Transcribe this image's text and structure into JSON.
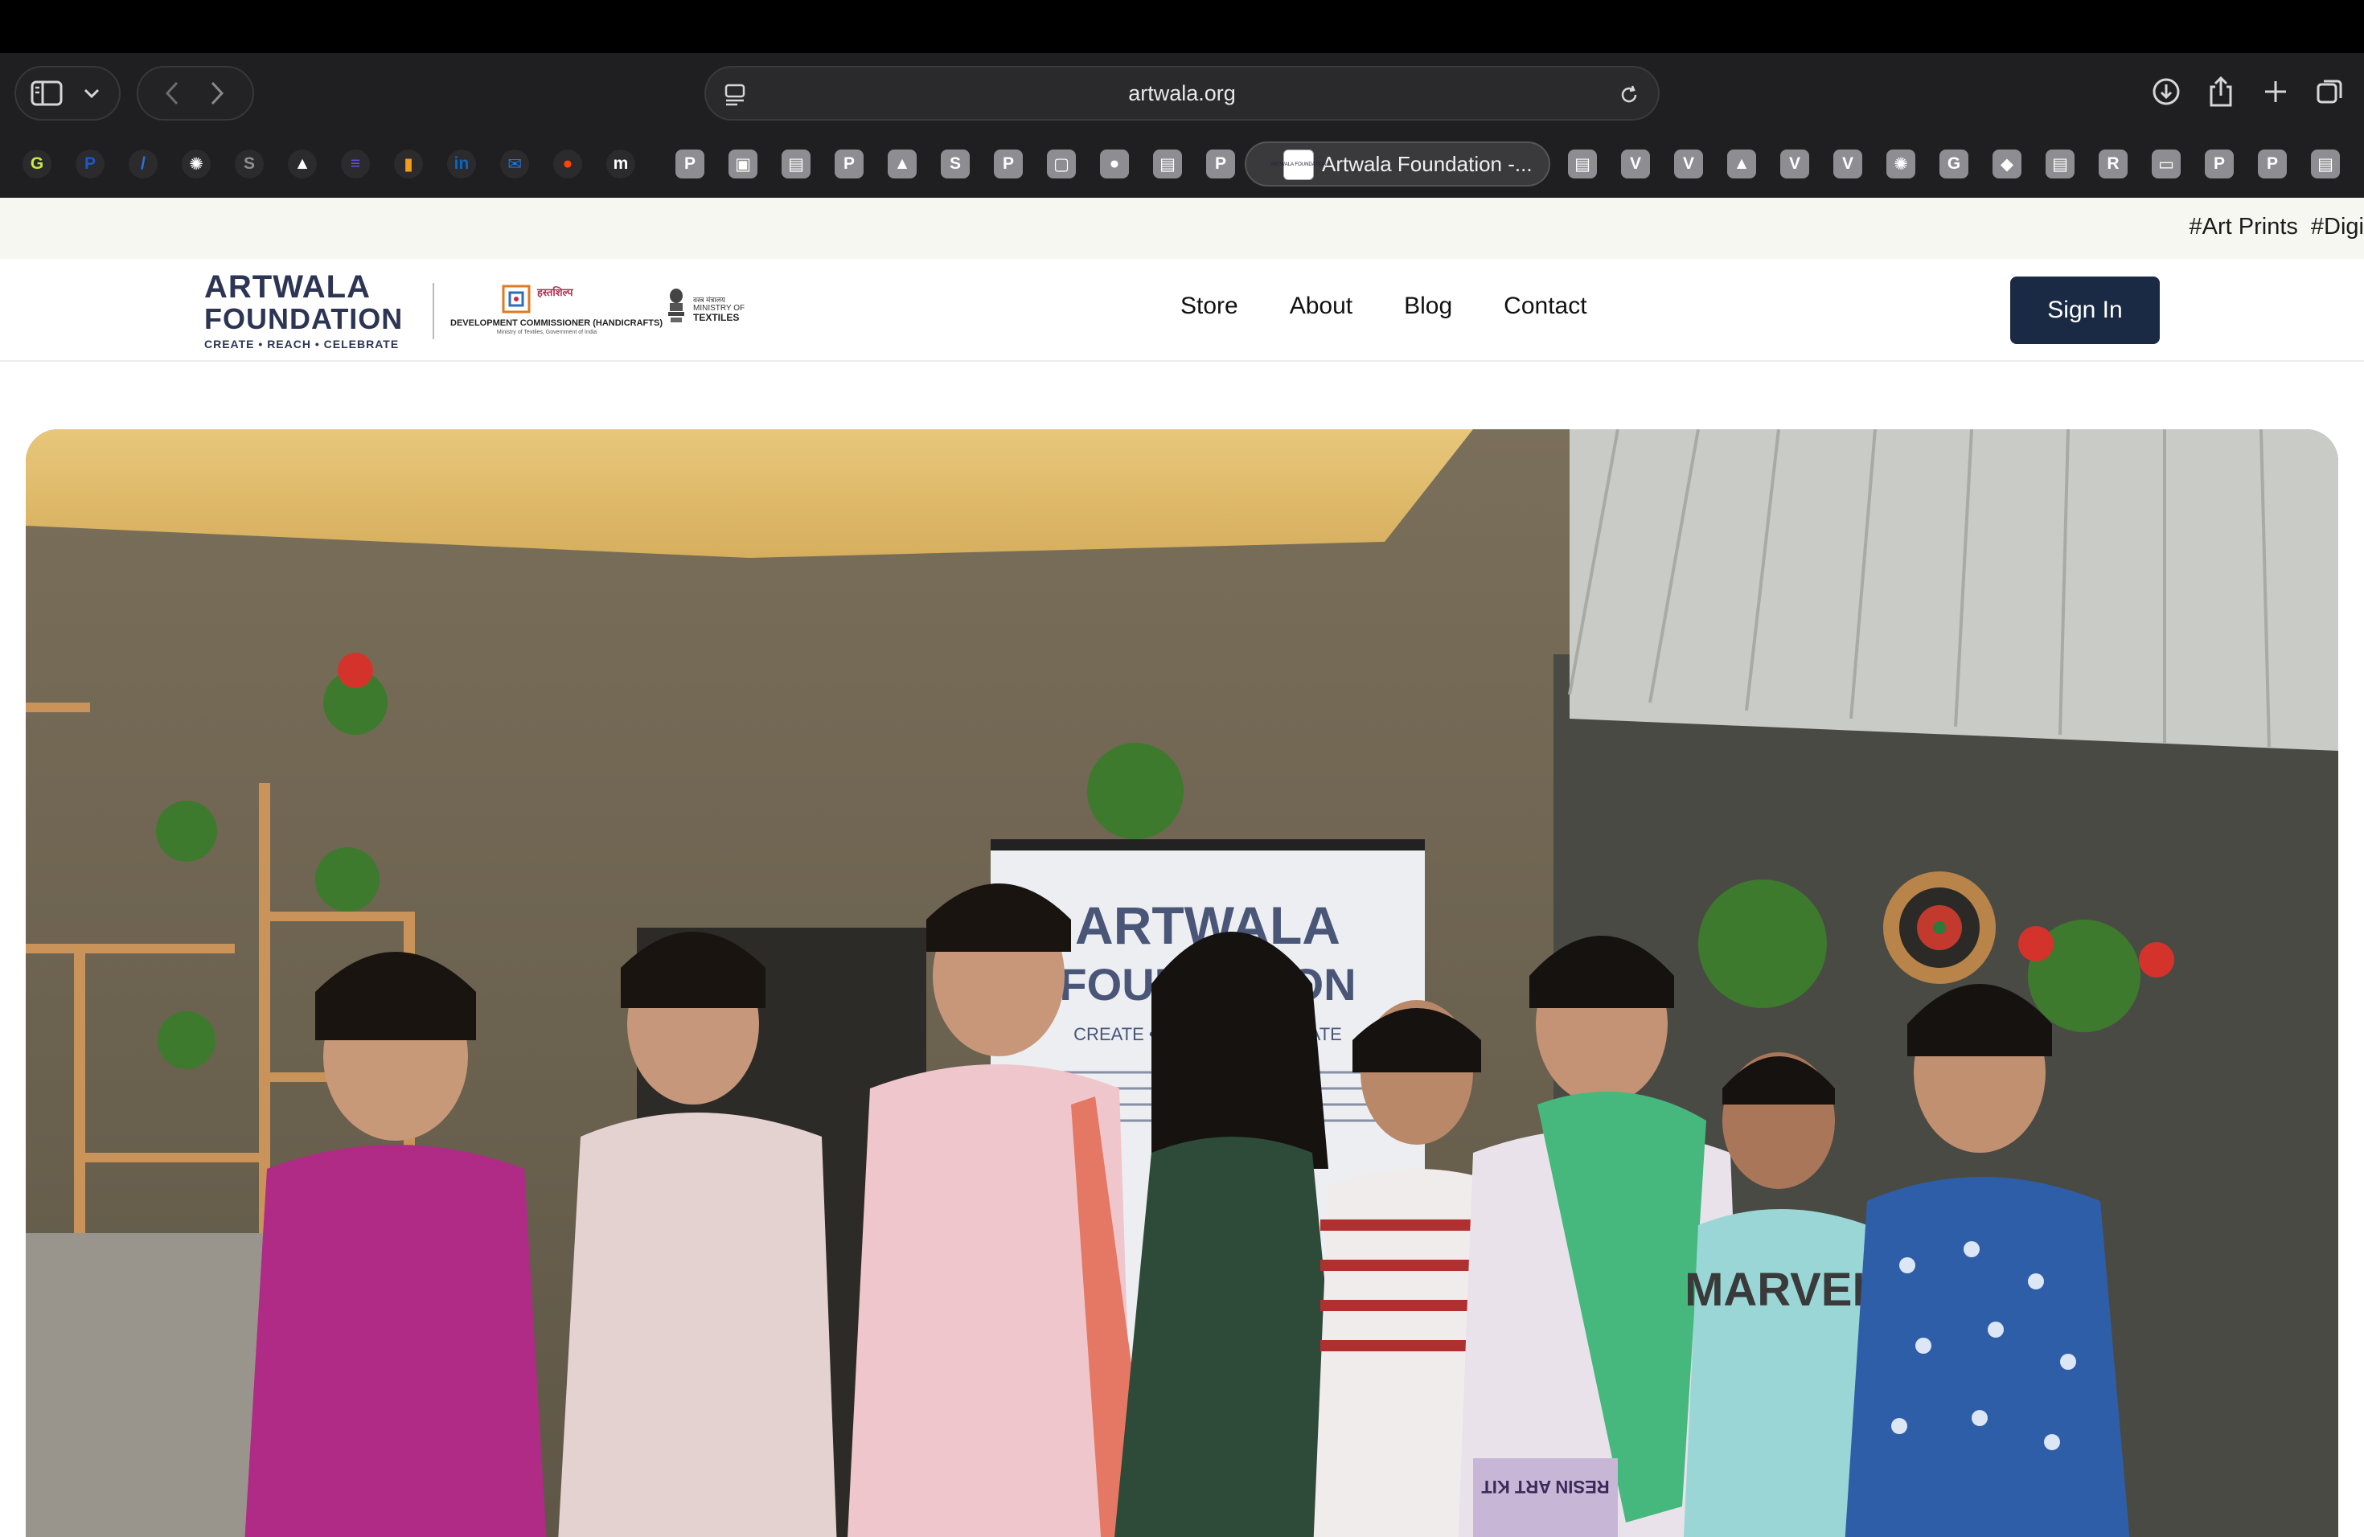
{
  "browser": {
    "url": "artwala.org",
    "active_tab_title": "Artwala Foundation -...",
    "active_tab_favicon_text": "ARTWALA FOUNDATION",
    "pinned_tabs_left": [
      {
        "icon": "chatgpt-like-yellow-icon",
        "glyph": "G",
        "color": "#c9e84a"
      },
      {
        "icon": "paypal-icon",
        "glyph": "P",
        "color": "#1d58c8"
      },
      {
        "icon": "slash-blue-icon",
        "glyph": "/",
        "color": "#2c6fe0"
      },
      {
        "icon": "openai-icon",
        "glyph": "✺",
        "color": "#ffffff"
      },
      {
        "icon": "s-gray-icon",
        "glyph": "S",
        "color": "#8e8e92"
      },
      {
        "icon": "triangle-white-icon",
        "glyph": "▲",
        "color": "#ffffff"
      },
      {
        "icon": "purple-square-icon",
        "glyph": "≡",
        "color": "#6b4de6"
      },
      {
        "icon": "bar-chart-orange-icon",
        "glyph": "▮",
        "color": "#f29b1d"
      },
      {
        "icon": "linkedin-icon",
        "glyph": "in",
        "color": "#0a66c2"
      },
      {
        "icon": "outlook-icon",
        "glyph": "✉",
        "color": "#1a7ad9"
      },
      {
        "icon": "reddit-icon",
        "glyph": "●",
        "color": "#ff4500"
      },
      {
        "icon": "medium-icon",
        "glyph": "m",
        "color": "#ffffff"
      }
    ],
    "tabs_left": [
      "P",
      "▣",
      "▤",
      "P",
      "▲",
      "S",
      "P",
      "▢",
      "●",
      "▤",
      "P"
    ],
    "tabs_right": [
      "▤",
      "V",
      "V",
      "▲",
      "V",
      "V",
      "✺",
      "G",
      "◆",
      "▤",
      "R",
      "▭",
      "P",
      "P",
      "▤"
    ]
  },
  "hashtags": [
    "#Art Prints",
    "#Digi"
  ],
  "site": {
    "brand_line1": "ARTWALA",
    "brand_line2": "FOUNDATION",
    "brand_tagline": "CREATE  •  REACH  •  CELEBRATE",
    "dch_title": "हस्तशिल्प",
    "dch_caption": "DEVELOPMENT COMMISSIONER (HANDICRAFTS)",
    "dch_subcaption": "Ministry of Textiles, Government of India",
    "mot_line1": "वस्त्र मंत्रालय",
    "mot_line2": "MINISTRY OF",
    "mot_line3": "TEXTILES",
    "nav": [
      "Store",
      "About",
      "Blog",
      "Contact"
    ],
    "signin_label": "Sign In"
  },
  "hero": {
    "banner_line1": "ARTWALA",
    "banner_line2": "FOUNDATION",
    "banner_tagline": "CREATE • REACH • CELEBRATE",
    "tshirt_text": "MARVEL",
    "box_text": "RESIN ART KIT"
  },
  "colors": {
    "brand_navy": "#2c3554",
    "button_navy": "#1b2a44",
    "chrome_bg": "#1f1f21",
    "hashtag_bg": "#f7f7f2"
  }
}
